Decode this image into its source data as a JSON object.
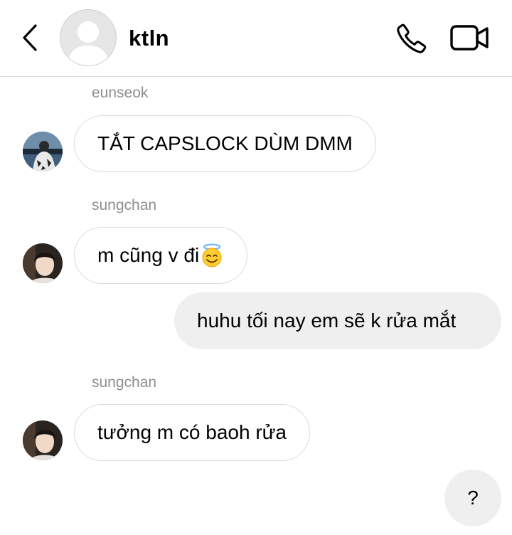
{
  "header": {
    "title": "ktln",
    "back_icon": "chevron-left-icon",
    "call_icon": "phone-icon",
    "video_icon": "video-camera-icon"
  },
  "messages": [
    {
      "sender": "eunseok",
      "text": "TẮT CAPSLOCK DÙM DMM",
      "direction": "incoming"
    },
    {
      "sender": "sungchan",
      "text": "m cũng v đi",
      "emoji": "smiling-face-with-halo-emoji",
      "direction": "incoming"
    },
    {
      "text": "huhu tối nay em sẽ k rửa mắt",
      "direction": "outgoing"
    },
    {
      "sender": "sungchan",
      "text": "tưởng m có baoh rửa",
      "direction": "incoming"
    },
    {
      "text": "?",
      "direction": "outgoing"
    }
  ],
  "colors": {
    "bubble_out_bg": "#efefef",
    "bubble_in_border": "#dbdbdb",
    "sender_text": "#8e8e8e"
  }
}
